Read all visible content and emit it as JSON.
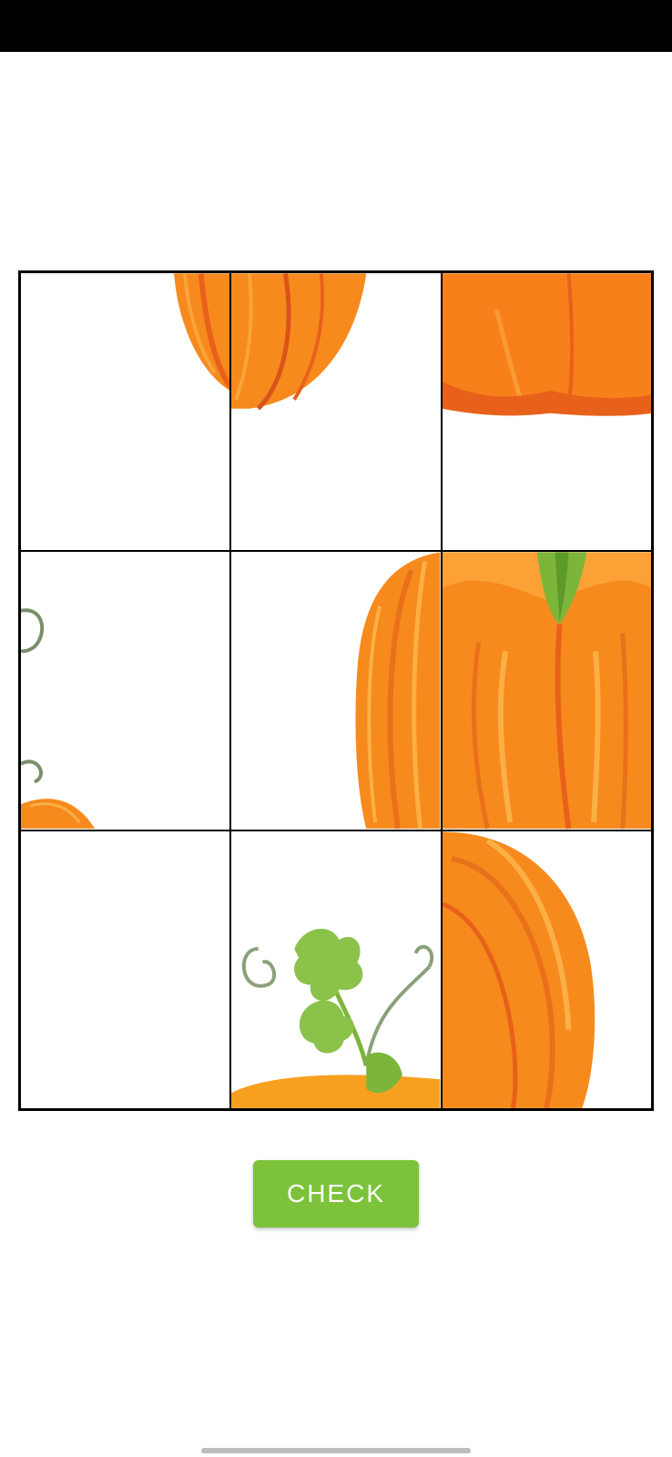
{
  "puzzle": {
    "grid": "3x3",
    "image": "pumpkin",
    "tiles": [
      {
        "piece": "pumpkin-top-left-edge"
      },
      {
        "piece": "pumpkin-top-middle"
      },
      {
        "piece": "pumpkin-top-right"
      },
      {
        "piece": "vine-curls-left"
      },
      {
        "piece": "pumpkin-left-side"
      },
      {
        "piece": "pumpkin-stem-center"
      },
      {
        "piece": "blank"
      },
      {
        "piece": "leaves-and-vines"
      },
      {
        "piece": "pumpkin-right-side"
      }
    ]
  },
  "actions": {
    "check_label": "CHECK"
  },
  "colors": {
    "accent": "#7cc33b",
    "pumpkin": "#f78a1d",
    "pumpkin_dark": "#e8611a",
    "stem": "#7cb53a"
  }
}
